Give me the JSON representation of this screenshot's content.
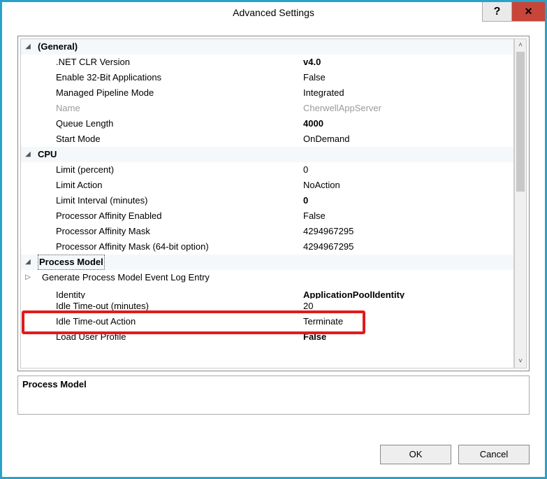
{
  "window": {
    "title": "Advanced Settings",
    "help": "?",
    "close": "×"
  },
  "groups": {
    "general": {
      "label": "(General)",
      "items": [
        {
          "label": ".NET CLR Version",
          "value": "v4.0",
          "bold": true
        },
        {
          "label": "Enable 32-Bit Applications",
          "value": "False"
        },
        {
          "label": "Managed Pipeline Mode",
          "value": "Integrated"
        },
        {
          "label": "Name",
          "value": "CherwellAppServer",
          "disabled": true
        },
        {
          "label": "Queue Length",
          "value": "4000",
          "bold": true
        },
        {
          "label": "Start Mode",
          "value": "OnDemand"
        }
      ]
    },
    "cpu": {
      "label": "CPU",
      "items": [
        {
          "label": "Limit (percent)",
          "value": "0"
        },
        {
          "label": "Limit Action",
          "value": "NoAction"
        },
        {
          "label": "Limit Interval (minutes)",
          "value": "0",
          "bold": true
        },
        {
          "label": "Processor Affinity Enabled",
          "value": "False"
        },
        {
          "label": "Processor Affinity Mask",
          "value": "4294967295"
        },
        {
          "label": "Processor Affinity Mask (64-bit option)",
          "value": "4294967295"
        }
      ]
    },
    "pm": {
      "label": "Process Model",
      "items": [
        {
          "label": "Generate Process Model Event Log Entry",
          "value": ""
        },
        {
          "label": "Identity",
          "value": "ApplicationPoolIdentity",
          "bold": true,
          "cut": true
        },
        {
          "label": "Idle Time-out (minutes)",
          "value": "20",
          "hl": true
        },
        {
          "label": "Idle Time-out Action",
          "value": "Terminate"
        },
        {
          "label": "Load User Profile",
          "value": "False",
          "bold": true
        }
      ]
    }
  },
  "description": {
    "title": "Process Model"
  },
  "buttons": {
    "ok": "OK",
    "cancel": "Cancel"
  }
}
